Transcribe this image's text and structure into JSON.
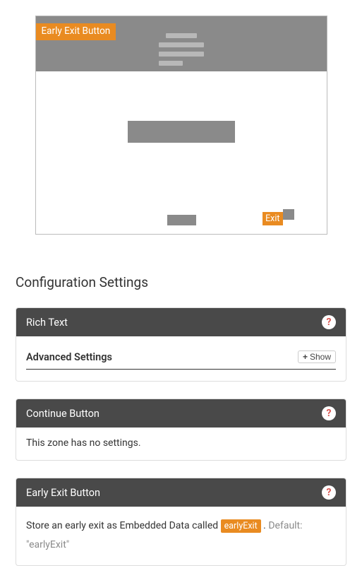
{
  "preview": {
    "earlyExitLabel": "Early Exit Button",
    "exitChip": "Exit"
  },
  "sectionTitle": "Configuration Settings",
  "panels": {
    "richText": {
      "title": "Rich Text",
      "advanced": "Advanced Settings",
      "showLabel": "Show"
    },
    "continueButton": {
      "title": "Continue Button",
      "body": "This zone has no settings."
    },
    "earlyExit": {
      "title": "Early Exit Button",
      "lead": "Store an early exit as Embedded Data called ",
      "code": "earlyExit",
      "afterCode": " . ",
      "defaultPrefix": "Default: ",
      "defaultValue": "\"earlyExit\""
    }
  },
  "helpGlyph": "?"
}
